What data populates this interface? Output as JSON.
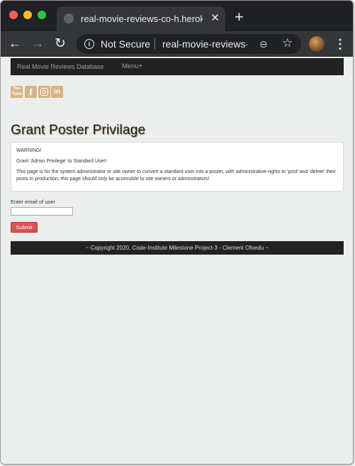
{
  "browser": {
    "tab_title": "real-movie-reviews-co-h.herokuapp.com",
    "tab_close": "✕",
    "new_tab": "+",
    "security_label": "Not Secure",
    "url": "real-movie-reviews-co-h.herokuapp.com",
    "icons": {
      "back": "arrow-left-icon",
      "forward": "arrow-right-icon",
      "reload": "reload-icon",
      "info": "info-icon",
      "zoom": "zoom-out-icon",
      "bookmark": "star-icon",
      "menu": "kebab-menu-icon"
    }
  },
  "site_nav": {
    "brand": "Real Movie Reviews Database",
    "menu_label": "Menu",
    "menu_caret": "▾"
  },
  "social": {
    "youtube_top": "You",
    "youtube_bottom": "Tube",
    "facebook": "f",
    "linkedin": "in",
    "accent_color": "#d6b483"
  },
  "main": {
    "title": "Grant Poster Privilage",
    "warning_heading": "WARNING!",
    "warning_subheading": "Grant 'Admin Privilege' to Standard User!",
    "warning_body": "This page is for the system administrator or site owner to convert a standard user into a poster, with administrative-rights to 'post' and 'delete' their posts in production, this page should only be accessible to site owners or adminstrators!",
    "email_label": "Enter email of user",
    "email_value": "",
    "submit_label": "Submit"
  },
  "footer": {
    "text": "~ Copyright 2020, Code-Institute Milestone Project-3 - Clement Ofoedu ~"
  }
}
